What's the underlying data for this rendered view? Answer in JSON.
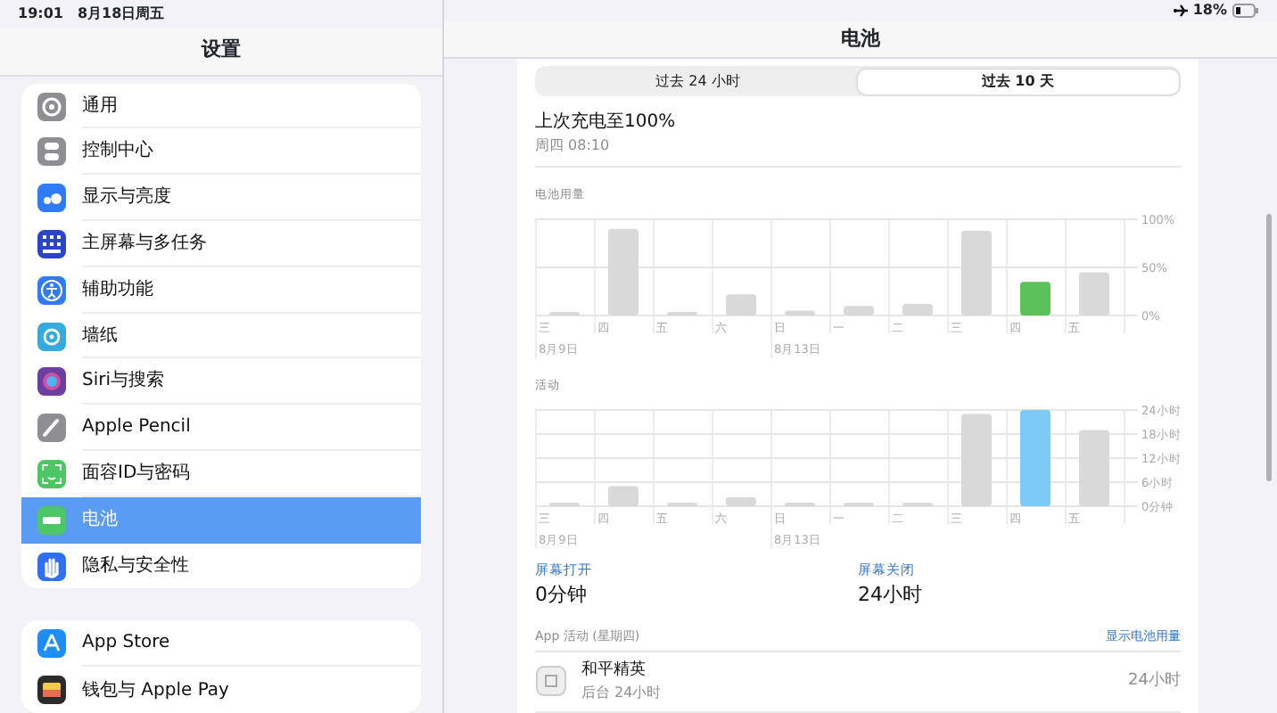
{
  "status_bar": {
    "time": "19:01",
    "date": "8月18日周五",
    "battery_percent": "18%"
  },
  "sidebar": {
    "title": "设置",
    "groups": [
      {
        "items": [
          {
            "label": "通用",
            "selected": false
          },
          {
            "label": "控制中心",
            "selected": false
          },
          {
            "label": "显示与亮度",
            "selected": false
          },
          {
            "label": "主屏幕与多任务",
            "selected": false
          },
          {
            "label": "辅助功能",
            "selected": false
          },
          {
            "label": "墙纸",
            "selected": false
          },
          {
            "label": "Siri与搜索",
            "selected": false
          },
          {
            "label": "Apple Pencil",
            "selected": false
          },
          {
            "label": "面容ID与密码",
            "selected": false
          },
          {
            "label": "电池",
            "selected": true
          },
          {
            "label": "隐私与安全性",
            "selected": false
          }
        ]
      },
      {
        "items": [
          {
            "label": "App Store",
            "selected": false
          },
          {
            "label": "钱包与 Apple Pay",
            "selected": false
          }
        ]
      }
    ]
  },
  "detail": {
    "title": "电池",
    "segments": [
      {
        "label": "过去 24 小时",
        "selected": false
      },
      {
        "label": "过去 10 天",
        "selected": true
      }
    ],
    "last_charge": {
      "title": "上次充电至100%",
      "time": "周四 08:10"
    },
    "usage_chart": {
      "label": "电池用量",
      "chart_data": {
        "type": "bar",
        "categories": [
          "三",
          "四",
          "五",
          "六",
          "日",
          "一",
          "二",
          "三",
          "四",
          "五"
        ],
        "values": [
          0,
          90,
          0,
          22,
          5,
          10,
          12,
          88,
          35,
          45
        ],
        "colors": [
          "#d9d9d9",
          "#d9d9d9",
          "#d9d9d9",
          "#d9d9d9",
          "#d9d9d9",
          "#d9d9d9",
          "#d9d9d9",
          "#d9d9d9",
          "#5cc15b",
          "#d9d9d9"
        ],
        "ylim": [
          0,
          100
        ],
        "yticks": [
          {
            "value": 0,
            "label": "0%"
          },
          {
            "value": 50,
            "label": "50%"
          },
          {
            "value": 100,
            "label": "100%"
          }
        ],
        "grid": true
      },
      "date_labels": [
        "8月9日",
        "8月13日"
      ]
    },
    "activity_chart": {
      "label": "活动",
      "chart_data": {
        "type": "bar",
        "categories": [
          "三",
          "四",
          "五",
          "六",
          "日",
          "一",
          "二",
          "三",
          "四",
          "五"
        ],
        "values": [
          0,
          5,
          0,
          2.2,
          0,
          0,
          0.5,
          23,
          24,
          19
        ],
        "colors": [
          "#d9d9d9",
          "#d9d9d9",
          "#d9d9d9",
          "#d9d9d9",
          "#d9d9d9",
          "#d9d9d9",
          "#d9d9d9",
          "#d9d9d9",
          "#7ccaf5",
          "#d9d9d9"
        ],
        "ylim": [
          0,
          24
        ],
        "yticks": [
          {
            "value": 0,
            "label": "0分钟"
          },
          {
            "value": 6,
            "label": "6小时"
          },
          {
            "value": 12,
            "label": "12小时"
          },
          {
            "value": 18,
            "label": "18小时"
          },
          {
            "value": 24,
            "label": "24小时"
          }
        ],
        "grid": true
      },
      "date_labels": [
        "8月9日",
        "8月13日"
      ]
    },
    "screen_stats": [
      {
        "label": "屏幕打开",
        "value": "0分钟"
      },
      {
        "label": "屏幕关闭",
        "value": "24小时"
      }
    ],
    "app_activity": {
      "title": "App 活动 (星期四)",
      "link": "显示电池用量",
      "apps": [
        {
          "name": "和平精英",
          "detail": "后台 24小时",
          "time": "24小时"
        }
      ]
    }
  }
}
